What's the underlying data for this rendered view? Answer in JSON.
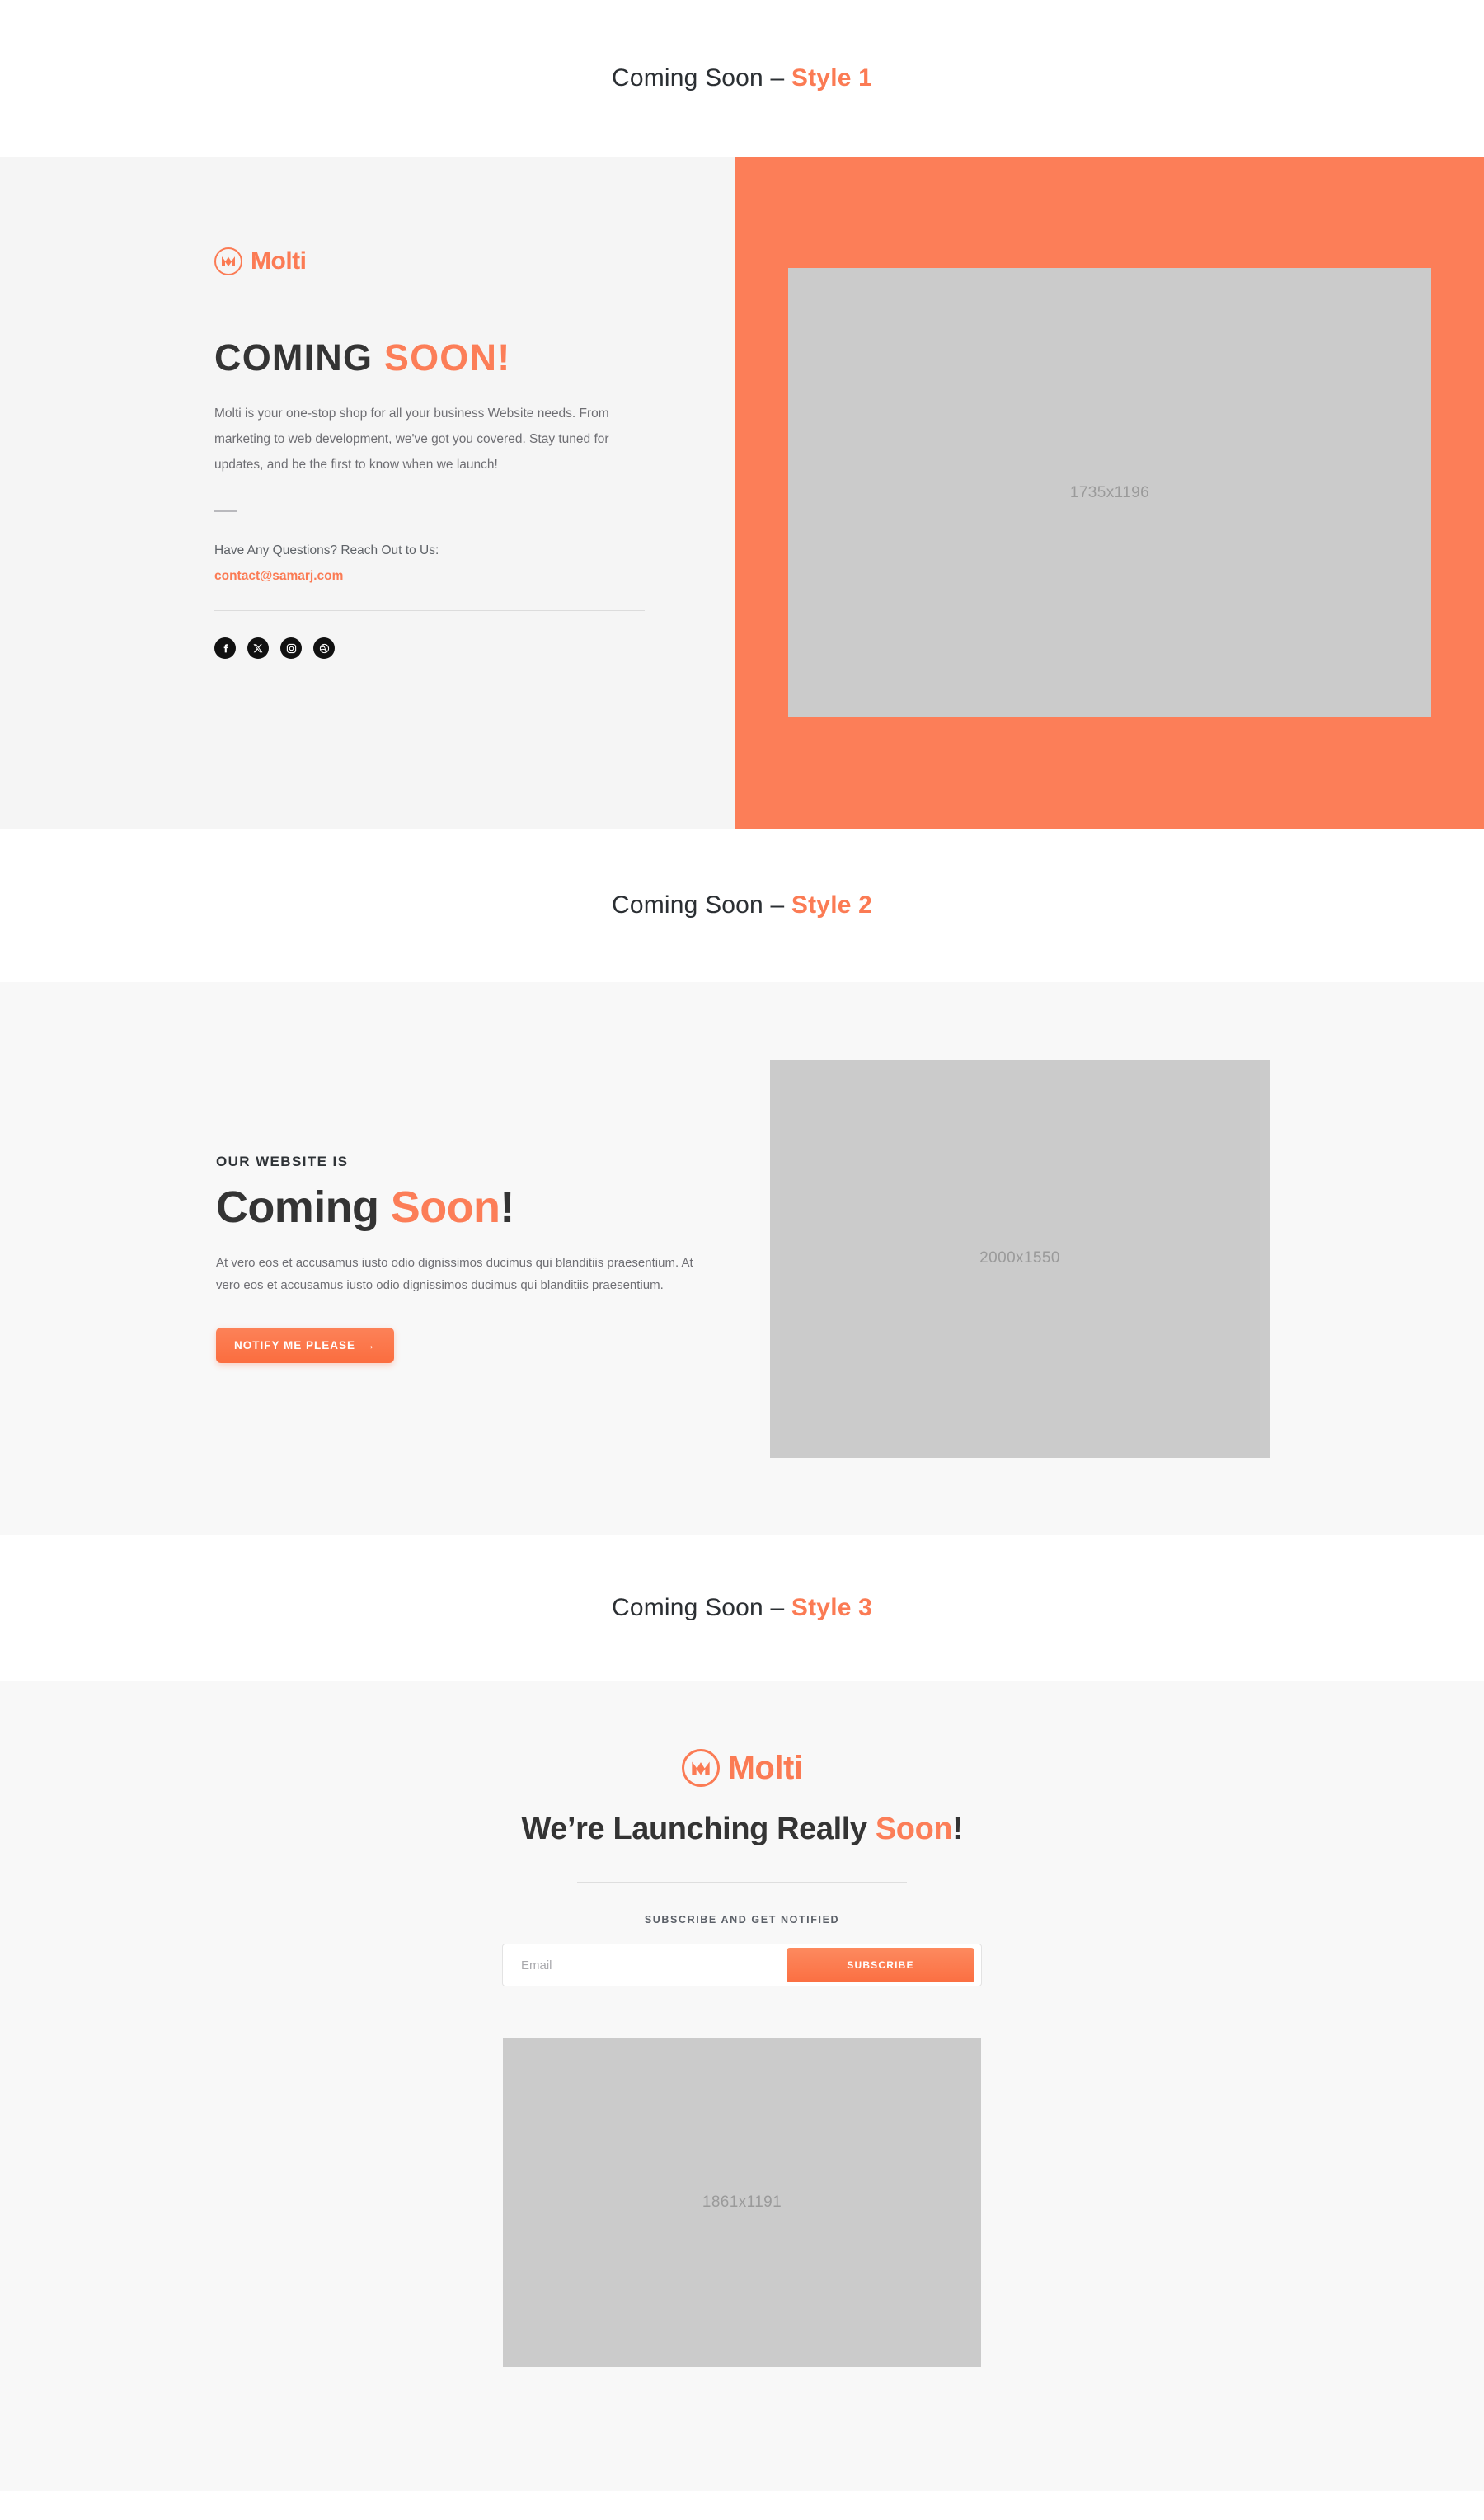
{
  "sections": [
    {
      "label_prefix": "Coming Soon – ",
      "label_accent": "Style 1"
    },
    {
      "label_prefix": "Coming Soon – ",
      "label_accent": "Style 2"
    },
    {
      "label_prefix": "Coming Soon – ",
      "label_accent": "Style 3"
    }
  ],
  "brand": {
    "name": "Molti",
    "accent_color": "#fb7b54",
    "panel_color": "#fc7e58"
  },
  "style1": {
    "heading_dark": "COMING ",
    "heading_accent": "SOON!",
    "body": "Molti is your one-stop shop for all your business Website needs. From marketing to web development, we've got you covered. Stay tuned for updates, and be the first to know when we launch!",
    "contact_label": "Have Any Questions? Reach Out to Us:",
    "email": "contact@samarj.com",
    "socials": [
      {
        "name": "facebook",
        "label": "Facebook"
      },
      {
        "name": "x-twitter",
        "label": "X"
      },
      {
        "name": "instagram",
        "label": "Instagram"
      },
      {
        "name": "dribbble",
        "label": "Dribbble"
      }
    ],
    "image_placeholder": "1735x1196"
  },
  "style2": {
    "eyebrow": "OUR WEBSITE IS",
    "heading_dark": "Coming ",
    "heading_accent": "Soon",
    "heading_tail": "!",
    "body": "At vero eos et accusamus iusto odio dignissimos ducimus qui blanditiis praesentium. At vero eos et accusamus iusto odio dignissimos ducimus qui blanditiis praesentium.",
    "button_label": "NOTIFY ME PLEASE",
    "button_arrow": "→",
    "image_placeholder": "2000x1550"
  },
  "style3": {
    "heading_dark": "We’re Launching Really ",
    "heading_accent": "Soon",
    "heading_tail": "!",
    "subscribe_label": "SUBSCRIBE AND GET NOTIFIED",
    "email_placeholder": "Email",
    "email_value": "",
    "subscribe_button": "SUBSCRIBE",
    "image_placeholder": "1861x1191"
  }
}
